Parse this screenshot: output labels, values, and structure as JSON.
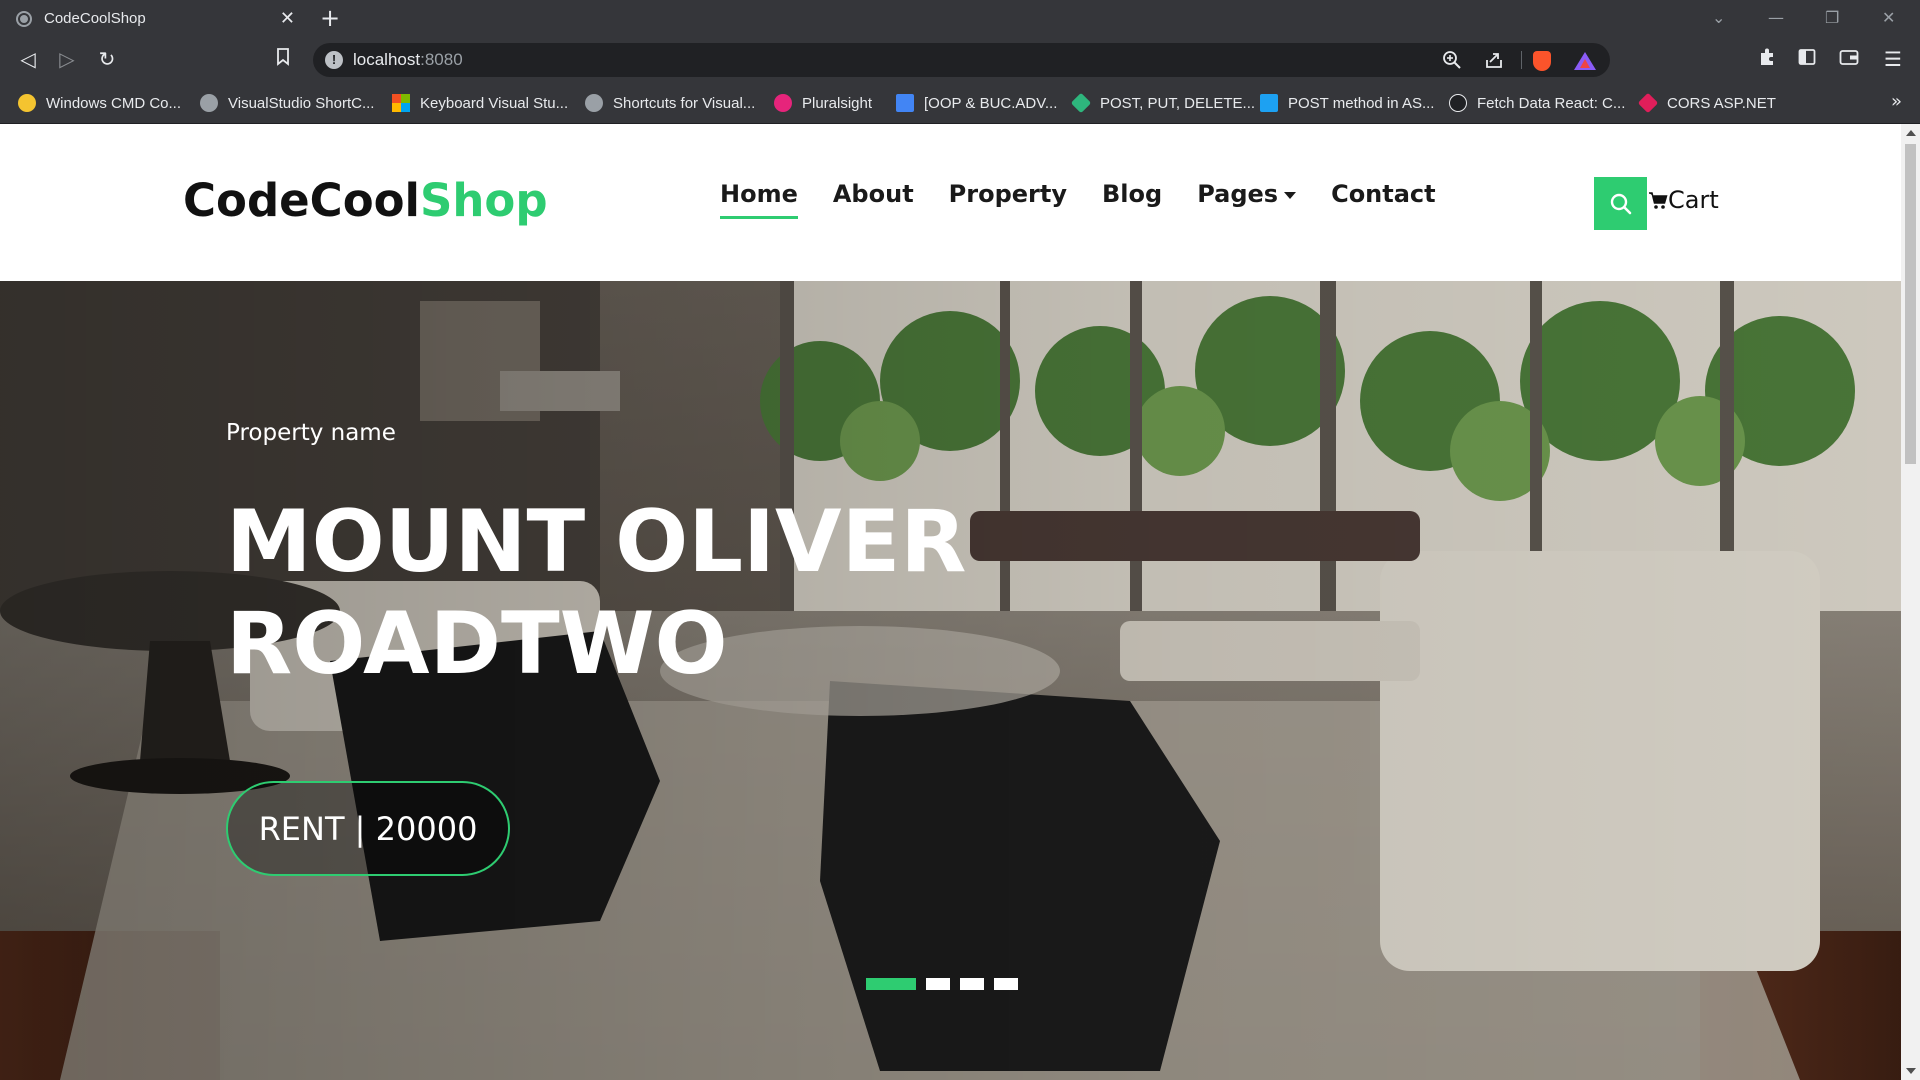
{
  "browser": {
    "tab_title": "CodeCoolShop",
    "url_host": "localhost",
    "url_port": ":8080",
    "bookmarks": [
      {
        "label": "Windows CMD Co...",
        "icon": "cmd-icon",
        "color": "#f4c430"
      },
      {
        "label": "VisualStudio ShortC...",
        "icon": "globe-icon",
        "color": "#9aa0a6"
      },
      {
        "label": "Keyboard Visual Stu...",
        "icon": "microsoft-icon",
        "color": "#f25022"
      },
      {
        "label": "Shortcuts for Visual...",
        "icon": "globe-icon",
        "color": "#9aa0a6"
      },
      {
        "label": "Pluralsight",
        "icon": "pluralsight-icon",
        "color": "#e6247b"
      },
      {
        "label": "[OOP & BUC.ADV...",
        "icon": "doc-icon",
        "color": "#4285f4"
      },
      {
        "label": "POST, PUT, DELETE...",
        "icon": "slack-icon",
        "color": "#2eb67d"
      },
      {
        "label": "POST method in AS...",
        "icon": "t-icon",
        "color": "#1da1f2"
      },
      {
        "label": "Fetch Data React: C...",
        "icon": "a-icon",
        "color": "#202124"
      },
      {
        "label": "CORS ASP.NET",
        "icon": "slack-icon",
        "color": "#e01e5a"
      }
    ]
  },
  "site": {
    "logo_main": "CodeCool",
    "logo_accent": "Shop",
    "nav": [
      {
        "label": "Home",
        "active": true
      },
      {
        "label": "About"
      },
      {
        "label": "Property"
      },
      {
        "label": "Blog"
      },
      {
        "label": "Pages",
        "dropdown": true
      },
      {
        "label": "Contact"
      }
    ],
    "cart_label": "Cart",
    "accent_color": "#2ecc71"
  },
  "hero": {
    "subtitle": "Property name",
    "title_line1": "MOUNT OLIVER",
    "title_line2": "ROADTWO",
    "price_button": "RENT | 20000",
    "slides_total": 4,
    "active_slide": 1
  }
}
